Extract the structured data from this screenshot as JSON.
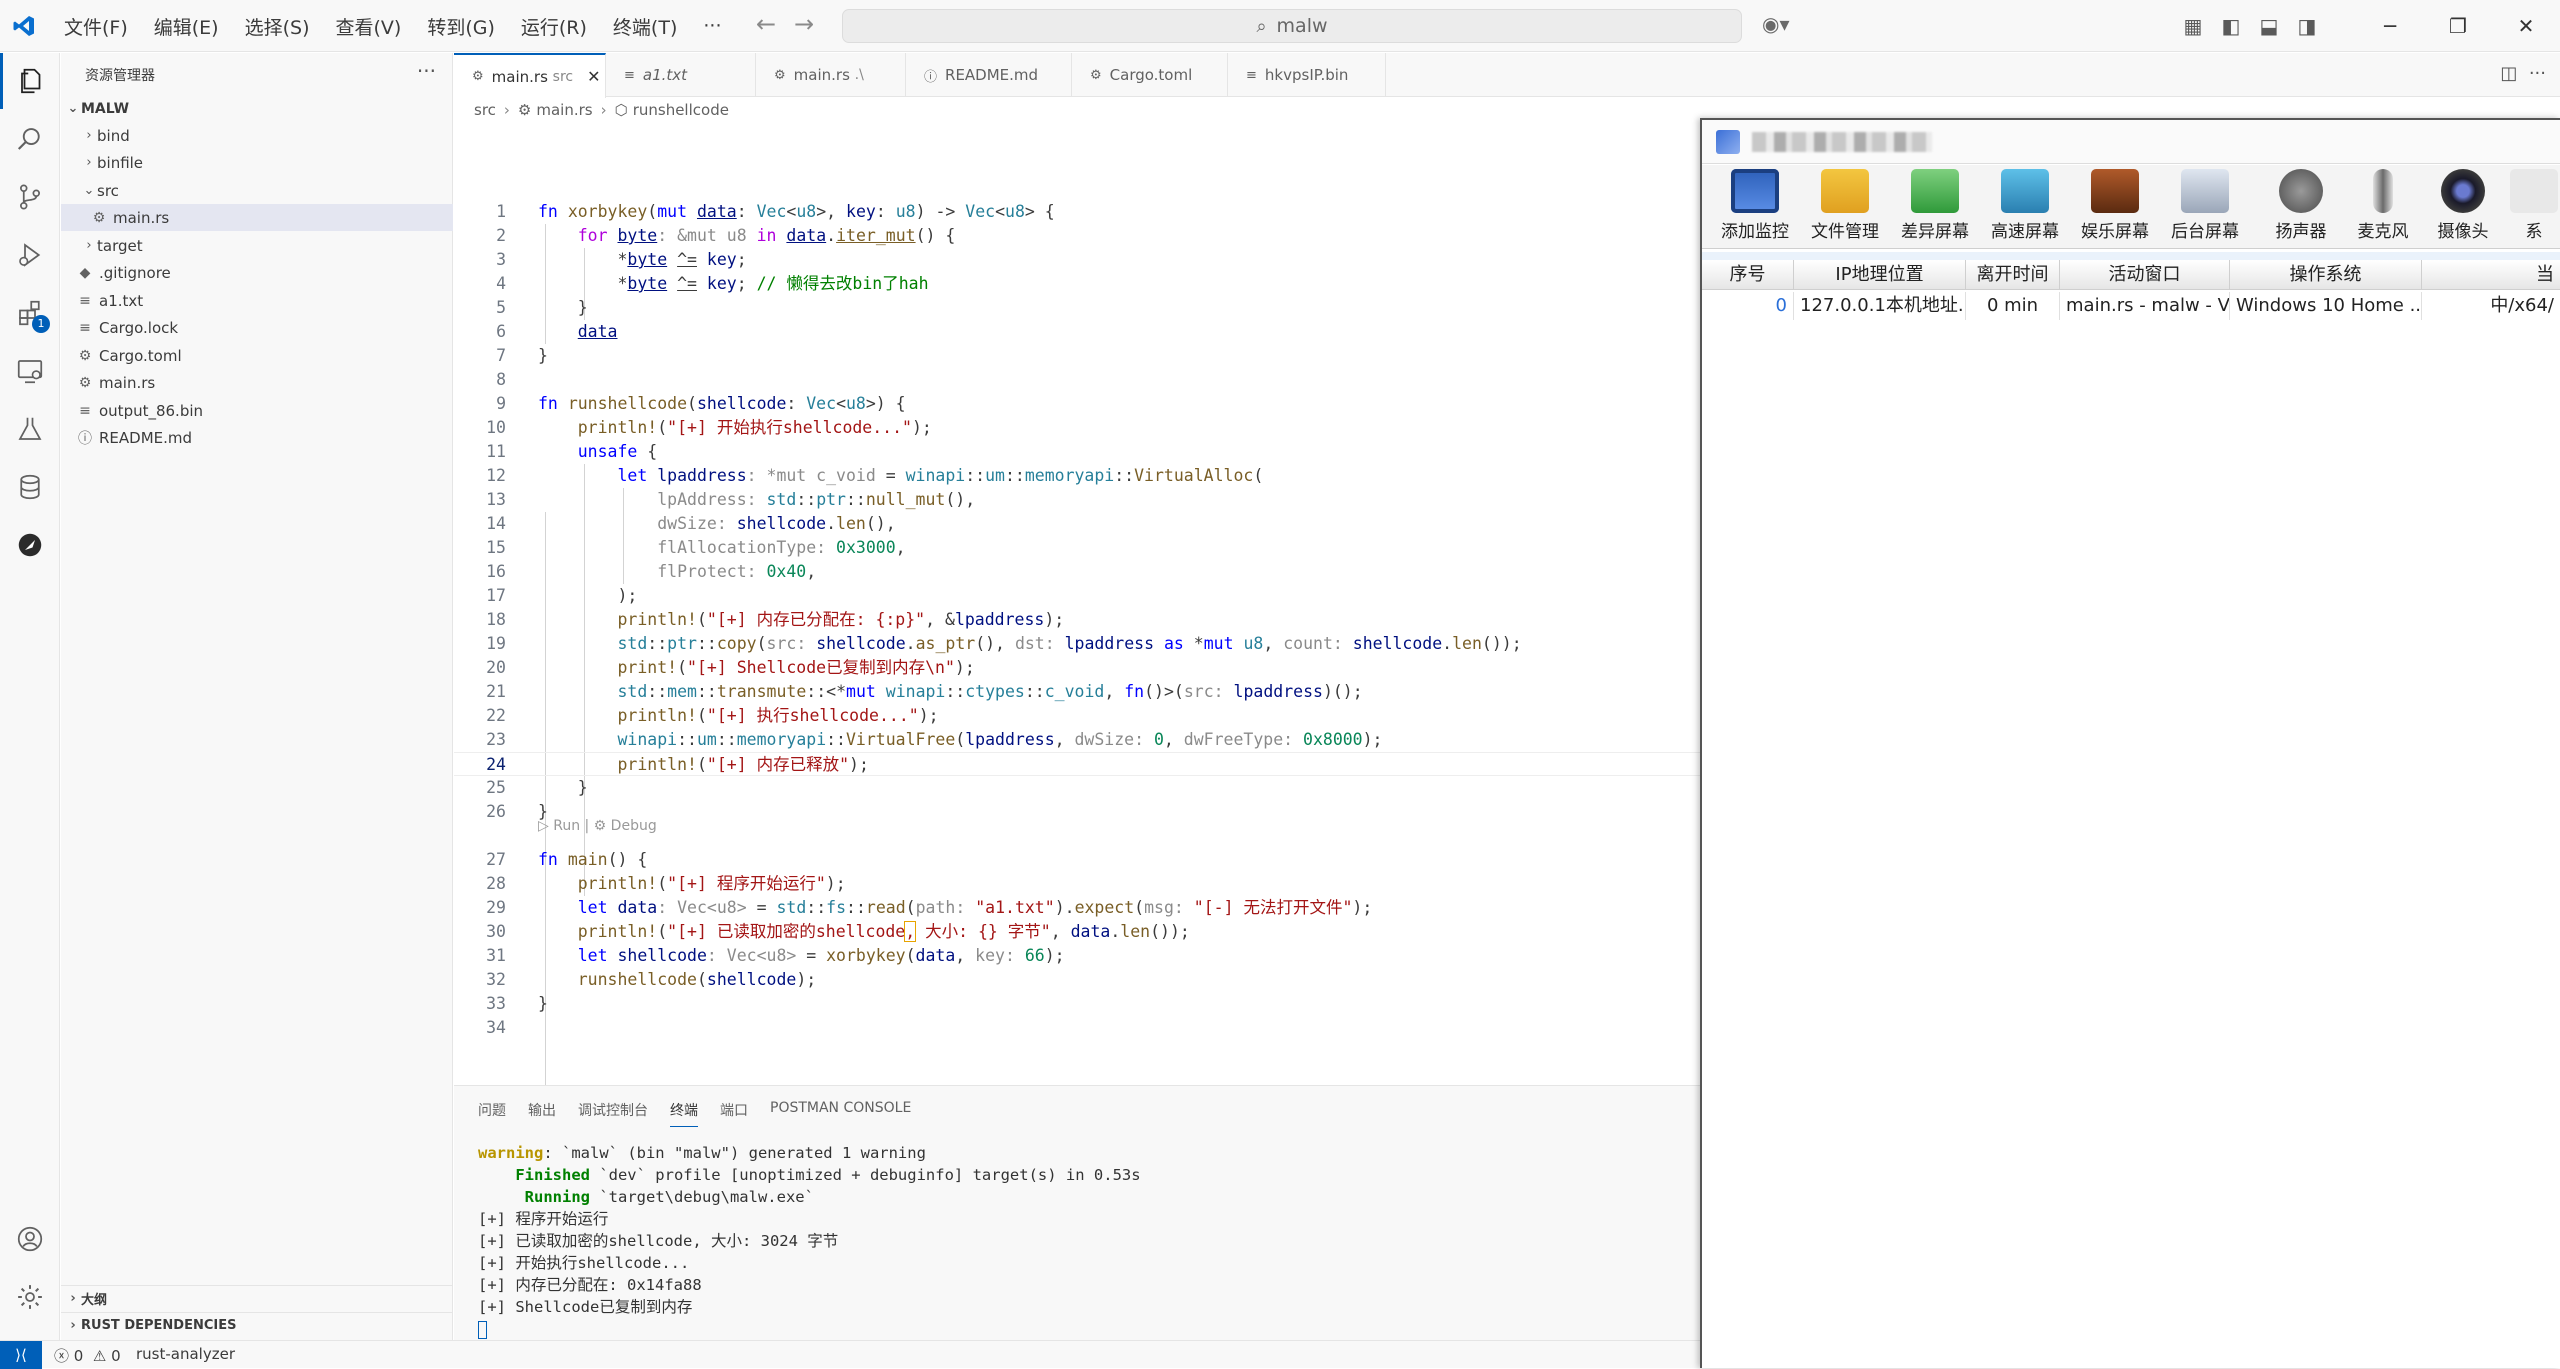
{
  "menu": [
    "文件(F)",
    "编辑(E)",
    "选择(S)",
    "查看(V)",
    "转到(G)",
    "运行(R)",
    "终端(T)",
    "···"
  ],
  "search": {
    "text": "malw"
  },
  "sidebar": {
    "title": "资源管理器",
    "root": "MALW",
    "items": [
      {
        "label": "bind",
        "kind": "folder"
      },
      {
        "label": "binfile",
        "kind": "folder"
      },
      {
        "label": "src",
        "kind": "folder-open"
      },
      {
        "label": "main.rs",
        "kind": "rust"
      },
      {
        "label": "target",
        "kind": "folder"
      },
      {
        "label": ".gitignore",
        "kind": "git"
      },
      {
        "label": "a1.txt",
        "kind": "text"
      },
      {
        "label": "Cargo.lock",
        "kind": "text"
      },
      {
        "label": "Cargo.toml",
        "kind": "gear"
      },
      {
        "label": "main.rs",
        "kind": "rust"
      },
      {
        "label": "output_86.bin",
        "kind": "text"
      },
      {
        "label": "README.md",
        "kind": "info"
      }
    ],
    "outline": "大纲",
    "rust_deps": "RUST DEPENDENCIES"
  },
  "tabs": [
    {
      "label": "main.rs",
      "desc": "src"
    },
    {
      "label": "a1.txt",
      "desc": ""
    },
    {
      "label": "main.rs",
      "desc": ".\\"
    },
    {
      "label": "README.md",
      "desc": ""
    },
    {
      "label": "Cargo.toml",
      "desc": ""
    },
    {
      "label": "hkvpsIP.bin",
      "desc": ""
    }
  ],
  "breadcrumb": [
    "src",
    "main.rs",
    "runshellcode"
  ],
  "codelens": "▷ Run | ⚙ Debug",
  "panel": {
    "tabs": [
      "问题",
      "输出",
      "调试控制台",
      "终端",
      "端口",
      "POSTMAN CONSOLE"
    ],
    "active": "终端",
    "lines": [
      "warning: `malw` (bin \"malw\") generated 1 warning",
      "    Finished `dev` profile [unoptimized + debuginfo] target(s) in 0.53s",
      "     Running `target\\debug\\malw.exe`",
      "[+] 程序开始运行",
      "[+] 已读取加密的shellcode, 大小: 3024 字节",
      "[+] 开始执行shellcode...",
      "[+] 内存已分配在: 0x14fa88",
      "[+] Shellcode已复制到内存"
    ]
  },
  "status": {
    "errors": "0",
    "warnings": "0",
    "lang_server": "rust-analyzer"
  },
  "rat": {
    "tools": [
      "添加监控",
      "文件管理",
      "差异屏幕",
      "高速屏幕",
      "娱乐屏幕",
      "后台屏幕",
      "扬声器",
      "麦克风",
      "摄像头",
      "系"
    ],
    "columns": [
      "序号",
      "IP地理位置",
      "离开时间",
      "活动窗口",
      "操作系统",
      "当"
    ],
    "row": [
      "0",
      "127.0.0.1本机地址...",
      "0 min",
      "main.rs - malw - Visua...",
      "Windows 10 Home ...",
      "中/x64/"
    ]
  },
  "accent": "#005fb8"
}
